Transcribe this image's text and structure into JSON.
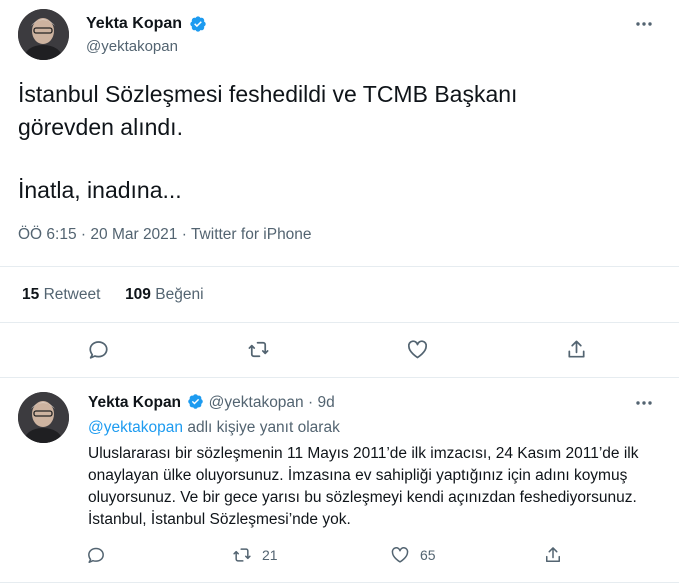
{
  "tweet": {
    "author_name": "Yekta Kopan",
    "author_handle": "@yektakopan",
    "text_line1": "İstanbul Sözleşmesi feshedildi ve TCMB Başkanı",
    "text_line2": "görevden alındı.",
    "text_line3": "İnatla, inadına...",
    "time": "ÖÖ 6:15",
    "date": "20 Mar 2021",
    "source": "Twitter for iPhone",
    "separator": "·",
    "retweet_count": "15",
    "retweet_label": "Retweet",
    "like_count": "109",
    "like_label": "Beğeni"
  },
  "reply": {
    "author_name": "Yekta Kopan",
    "author_handle": "@yektakopan",
    "separator": "·",
    "age": "9d",
    "replying_to_handle": "@yektakopan",
    "replying_to_suffix": "adlı kişiye yanıt olarak",
    "text": "Uluslararası bir sözleşmenin 11 Mayıs 2011’de ilk imzacısı, 24 Kasım 2011’de ilk onaylayan ülke oluyorsunuz. İmzasına ev sahipliği yaptığınız için adını koymuş oluyorsunuz. Ve bir gece yarısı bu sözleşmeyi kendi açınızdan feshediyorsunuz. İstanbul, İstanbul Sözleşmesi’nde yok.",
    "retweet_count": "21",
    "like_count": "65"
  },
  "colors": {
    "verified_blue": "#1d9bf0",
    "icon_gray": "#536471",
    "divider": "#e6ecf0"
  }
}
